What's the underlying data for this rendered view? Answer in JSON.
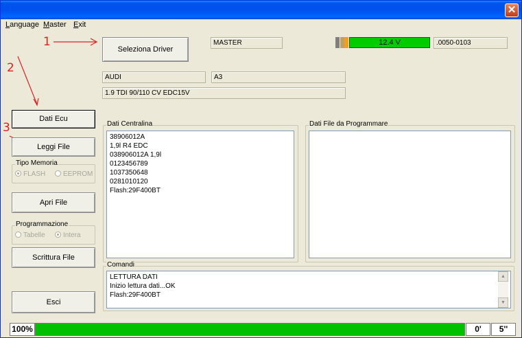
{
  "window": {
    "title": "",
    "close_symbol": "✕"
  },
  "menu": [
    {
      "prefix": "",
      "accel": "L",
      "rest": "anguage"
    },
    {
      "prefix": "",
      "accel": "M",
      "rest": "aster"
    },
    {
      "prefix": "",
      "accel": "E",
      "rest": "xit"
    }
  ],
  "annotations": {
    "one": "1",
    "two": "2",
    "three": "3"
  },
  "header": {
    "select_driver_label": "Seleziona Driver",
    "master_field": "MASTER",
    "voltage": "12.4 V",
    "version": ".0050-0103",
    "make": "AUDI",
    "model": "A3",
    "engine": "1.9 TDI 90/110 CV  EDC15V"
  },
  "sidebar": {
    "dati_ecu": "Dati Ecu",
    "leggi_file": "Leggi File",
    "tipo_memoria_label": "Tipo Memoria",
    "flash": "FLASH",
    "eeprom": "EEPROM",
    "apri_file": "Apri File",
    "programmazione_label": "Programmazione",
    "tabelle": "Tabelle",
    "intera": "Intera",
    "scrittura_file": "Scrittura File",
    "esci": "Esci"
  },
  "dati_centralina": {
    "label": "Dati Centralina",
    "lines": [
      "38906012A",
      "1,9l R4 EDC",
      "038906012A  1,9l",
      "0123456789",
      "1037350648",
      "0281010120",
      "Flash:29F400BT"
    ]
  },
  "dati_file": {
    "label": "Dati File da Programmare"
  },
  "comandi": {
    "label": "Comandi",
    "lines": [
      "LETTURA DATI",
      "Inizio lettura dati...OK",
      "Flash:29F400BT"
    ]
  },
  "status": {
    "percent": "100%",
    "progress": 1.0,
    "time_min": "0'",
    "time_sec": "5''"
  },
  "colors": {
    "progress": "#00c000",
    "voltage_ok": "#00cc00",
    "annotation": "#e02020"
  }
}
